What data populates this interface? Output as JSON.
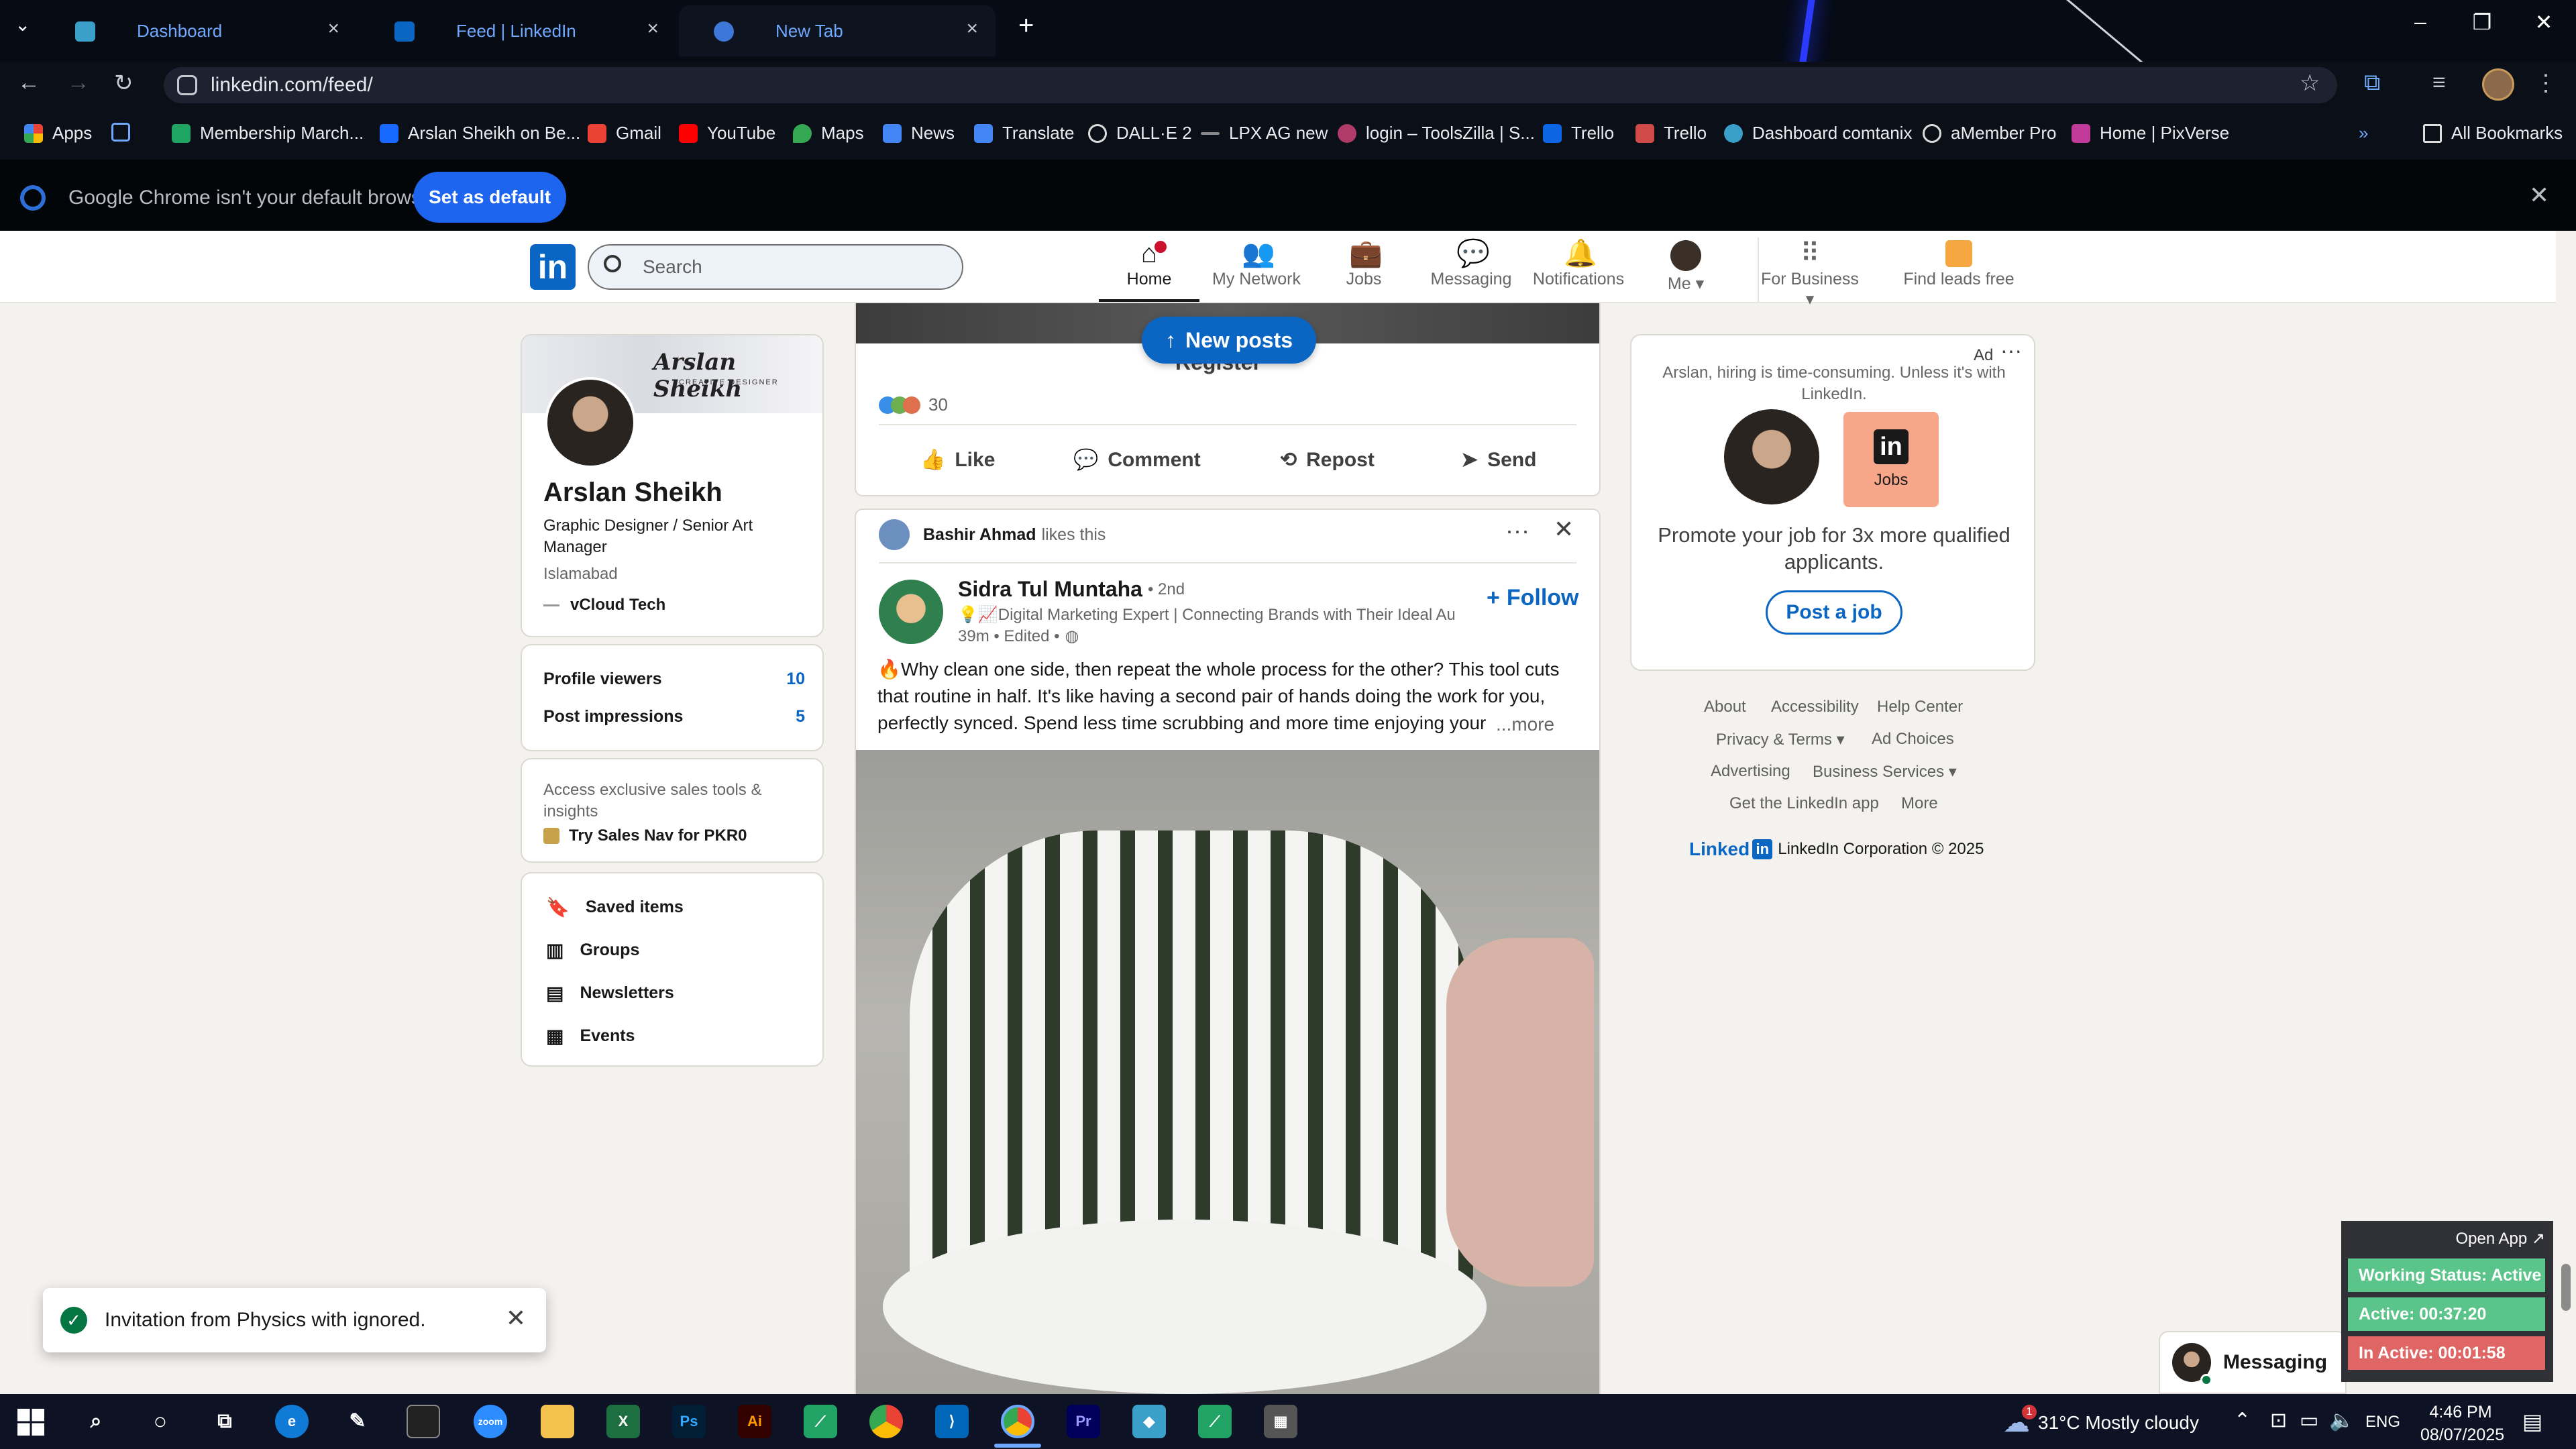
{
  "browser": {
    "tabs": [
      {
        "label": "Dashboard"
      },
      {
        "label": "Feed | LinkedIn"
      },
      {
        "label": "New Tab"
      }
    ],
    "url": "linkedin.com/feed/",
    "bookmarks": [
      {
        "label": "Apps"
      },
      {
        "label": "Membership March..."
      },
      {
        "label": "Arslan Sheikh on Be..."
      },
      {
        "label": "Gmail"
      },
      {
        "label": "YouTube"
      },
      {
        "label": "Maps"
      },
      {
        "label": "News"
      },
      {
        "label": "Translate"
      },
      {
        "label": "DALL·E 2"
      },
      {
        "label": "LPX AG new"
      },
      {
        "label": "login – ToolsZilla | S..."
      },
      {
        "label": "Trello"
      },
      {
        "label": "Trello"
      },
      {
        "label": "Dashboard comtanix"
      },
      {
        "label": "aMember Pro"
      },
      {
        "label": "Home | PixVerse"
      }
    ],
    "all_bookmarks": "All Bookmarks",
    "default_message": "Google Chrome isn't your default browser",
    "set_default": "Set as default"
  },
  "nav": {
    "search_placeholder": "Search",
    "items": [
      {
        "label": "Home"
      },
      {
        "label": "My Network"
      },
      {
        "label": "Jobs"
      },
      {
        "label": "Messaging"
      },
      {
        "label": "Notifications"
      },
      {
        "label": "Me"
      },
      {
        "label": "For Business"
      },
      {
        "label": "Find leads free"
      }
    ]
  },
  "profile": {
    "cover_text": "Arslan Sheikh",
    "cover_subtext": "CREATIVE DESIGNER",
    "name": "Arslan Sheikh",
    "headline": "Graphic Designer / Senior Art Manager",
    "location": "Islamabad",
    "company": "vCloud Tech",
    "stats": [
      {
        "label": "Profile viewers",
        "value": "10"
      },
      {
        "label": "Post impressions",
        "value": "5"
      }
    ],
    "premium_text": "Access exclusive sales tools & insights",
    "premium_cta": "Try Sales Nav for PKR0",
    "shortcuts": [
      {
        "label": "Saved items"
      },
      {
        "label": "Groups"
      },
      {
        "label": "Newsletters"
      },
      {
        "label": "Events"
      }
    ]
  },
  "feed": {
    "new_posts": "New posts",
    "register": "Register",
    "reaction_count": "30",
    "actions": [
      {
        "label": "Like"
      },
      {
        "label": "Comment"
      },
      {
        "label": "Repost"
      },
      {
        "label": "Send"
      }
    ],
    "post": {
      "context_name": "Bashir Ahmad",
      "context_text": "likes this",
      "author": "Sidra Tul Muntaha",
      "degree": "• 2nd",
      "author_headline": "💡📈Digital Marketing Expert | Connecting Brands with Their Ideal Audi...",
      "time": "39m • Edited •",
      "follow": "Follow",
      "text": "🔥Why clean one side, then repeat the whole process for the other? This tool cuts that routine in half. It's like having a second pair of hands doing the work for you, perfectly synced. Spend less time scrubbing and more time enjoying your",
      "more": "...more"
    }
  },
  "ad": {
    "label": "Ad",
    "text": "Arslan, hiring is time-consuming. Unless it's with LinkedIn.",
    "jobs_badge": "Jobs",
    "promo": "Promote your job for 3x more qualified applicants.",
    "cta": "Post a job"
  },
  "footer": {
    "row1": [
      "About",
      "Accessibility",
      "Help Center"
    ],
    "row2": [
      "Privacy & Terms",
      "Ad Choices"
    ],
    "row3": [
      "Advertising",
      "Business Services"
    ],
    "row4": [
      "Get the LinkedIn app",
      "More"
    ],
    "brand": "Linked",
    "copyright": "LinkedIn Corporation © 2025"
  },
  "toast": {
    "message": "Invitation from Physics with ignored."
  },
  "messaging": {
    "label": "Messaging"
  },
  "tracker": {
    "open_app": "Open App ↗",
    "working": "Working Status: Active",
    "active": "Active: 00:37:20",
    "inactive": "In Active: 00:01:58"
  },
  "taskbar": {
    "weather": "31°C  Mostly cloudy",
    "lang": "ENG",
    "time": "4:46 PM",
    "date": "08/07/2025",
    "weather_badge": "1"
  },
  "colors": {
    "linkedin_blue": "#0a66c2",
    "chrome_blue": "#1d64ef",
    "tracker_green": "#5bc48a",
    "tracker_red": "#e06666"
  }
}
